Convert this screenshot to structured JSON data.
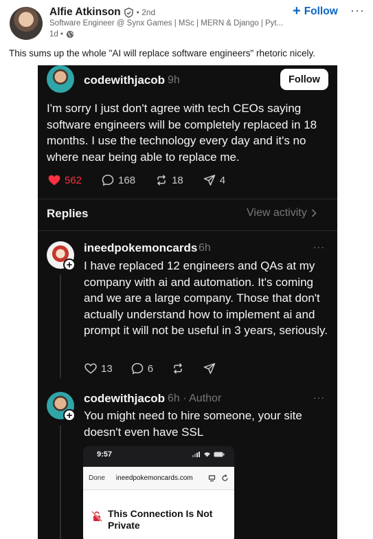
{
  "linkedin": {
    "author_name": "Alfie Atkinson",
    "connection_degree": "• 2nd",
    "headline": "Software Engineer @ Synx Games | MSc | MERN & Django | Pyt...",
    "time_ago": "1d •",
    "follow_label": "Follow",
    "more_label": "···",
    "commentary": "This sums up the whole \"AI will replace software engineers\" rhetoric nicely.",
    "accent_color": "#0a66c2"
  },
  "threads": {
    "original_post": {
      "username": "codewithjacob",
      "time": "9h",
      "follow_label": "Follow",
      "text": "I'm sorry I just don't agree with tech CEOs saying software engineers will be completely replaced in 18 months. I use the technology every day and it's no where near being able to replace me.",
      "likes": "562",
      "comments": "168",
      "reposts": "18",
      "shares": "4",
      "like_color": "#ff3040"
    },
    "replies_label": "Replies",
    "view_activity_label": "View activity",
    "reply_1": {
      "username": "ineedpokemoncards",
      "time": "6h",
      "text": "I have replaced 12 engineers and QAs at my company with ai and automation. It's coming and we are a large company. Those that don't actually understand how to implement ai and prompt it will not be useful in 3 years, seriously.",
      "likes": "13",
      "comments": "6",
      "more_label": "···"
    },
    "reply_2": {
      "username": "codewithjacob",
      "time": "6h · Author",
      "text": "You might need to hire someone, your site doesn't even have SSL",
      "more_label": "···"
    },
    "phone_screenshot": {
      "clock": "9:57",
      "done_label": "Done",
      "url": "ineedpokemoncards.com",
      "warning_title": "This Connection Is Not Private"
    }
  }
}
